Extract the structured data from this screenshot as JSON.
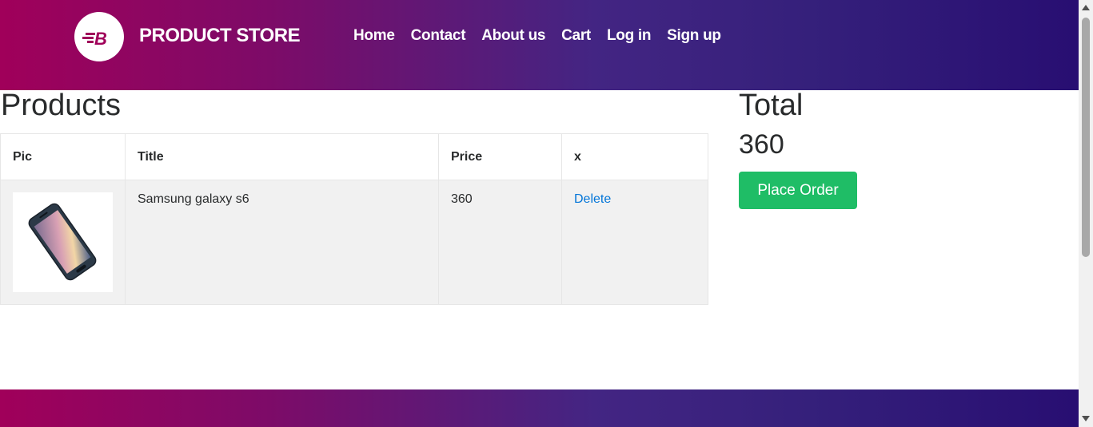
{
  "navbar": {
    "brand": "PRODUCT STORE",
    "logo_icon": "store-logo-icon",
    "links": [
      "Home",
      "Contact",
      "About us",
      "Cart",
      "Log in",
      "Sign up"
    ]
  },
  "products": {
    "title": "Products",
    "columns": [
      "Pic",
      "Title",
      "Price",
      "x"
    ],
    "rows": [
      {
        "pic": "phone-image",
        "title": "Samsung galaxy s6",
        "price": "360",
        "action": "Delete"
      }
    ]
  },
  "total": {
    "title": "Total",
    "value": "360",
    "order_button": "Place Order"
  },
  "colors": {
    "brand_gradient_start": "#a0005a",
    "brand_gradient_end": "#280e72",
    "order_button": "#1fbd66",
    "link": "#0275d8"
  }
}
